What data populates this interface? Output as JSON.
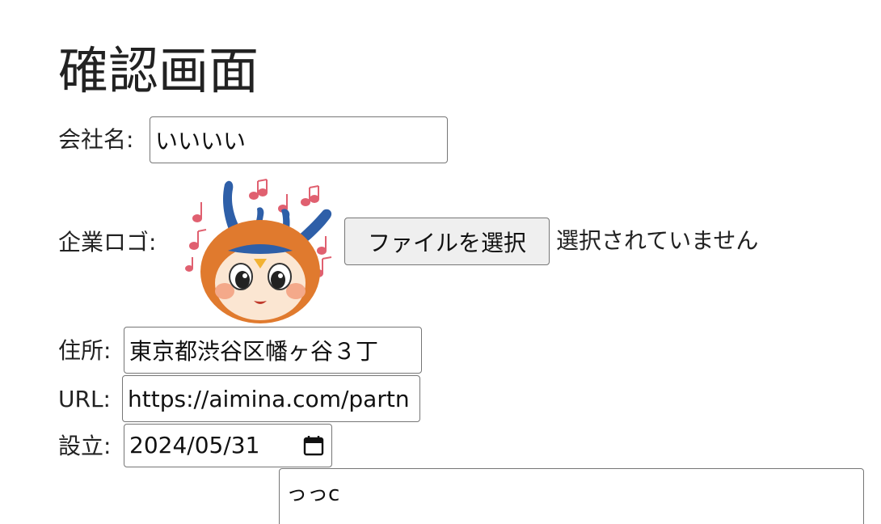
{
  "page": {
    "title": "確認画面"
  },
  "company": {
    "label": "会社名:",
    "value": "いいいい"
  },
  "logo": {
    "label": "企業ロゴ:",
    "file_button_label": "ファイルを選択",
    "file_status": "選択されていません",
    "image": "mascot-logo"
  },
  "address": {
    "label": "住所:",
    "value": "東京都渋谷区幡ヶ谷３丁"
  },
  "url": {
    "label": "URL:",
    "value": "https://aimina.com/partn"
  },
  "established": {
    "label": "設立:",
    "value": "2024/05/31",
    "icon": "calendar-icon"
  },
  "description": {
    "value": "っっc"
  }
}
